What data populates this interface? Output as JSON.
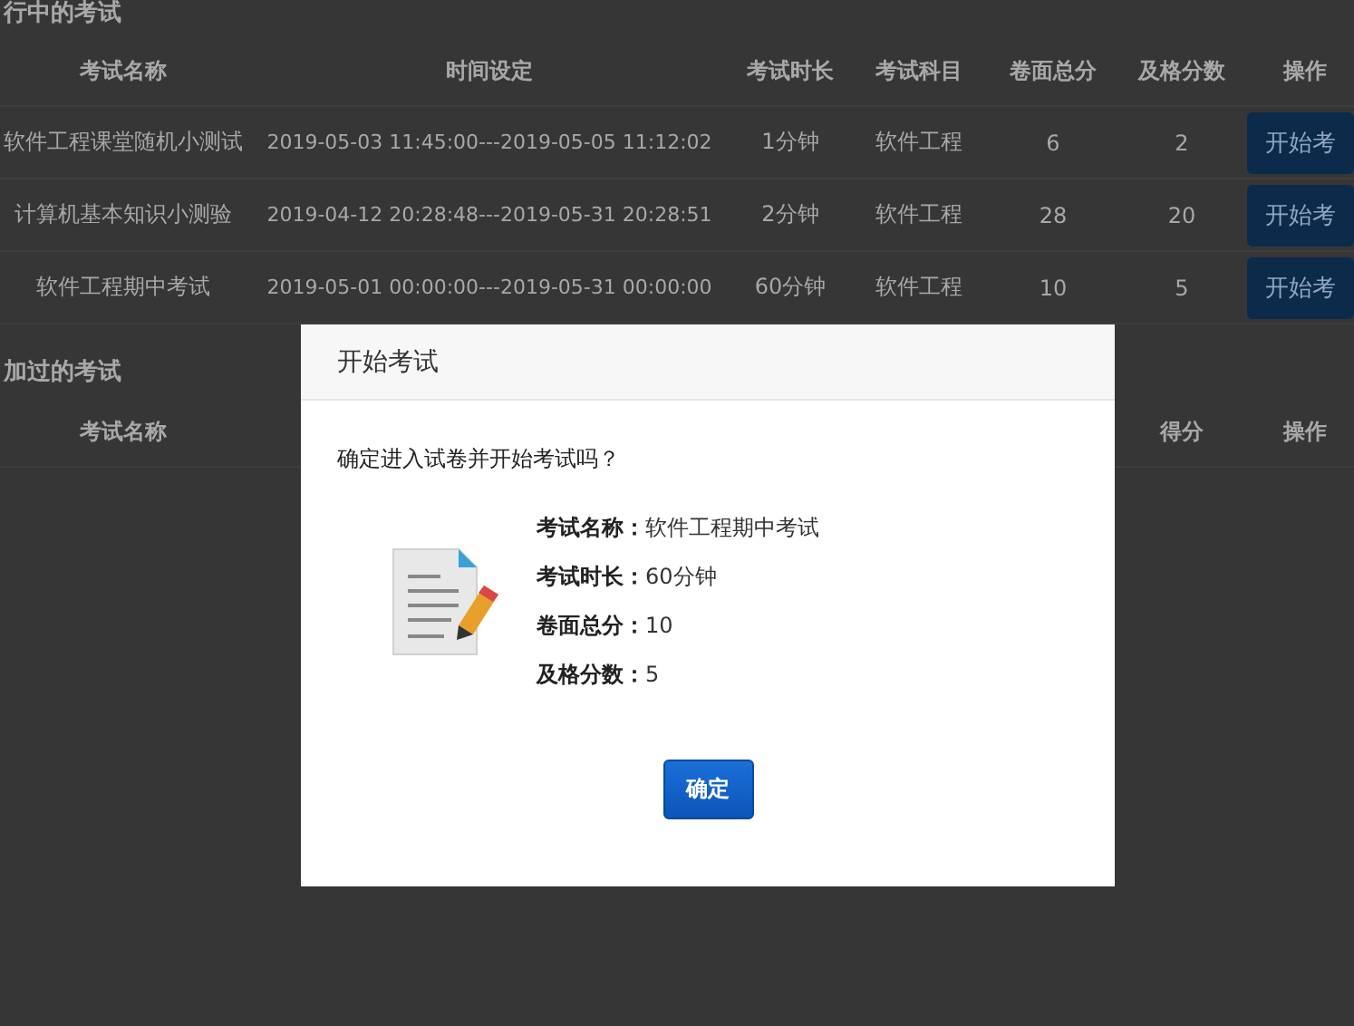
{
  "ongoing": {
    "title": "行中的考试",
    "columns": [
      "考试名称",
      "时间设定",
      "考试时长",
      "考试科目",
      "卷面总分",
      "及格分数",
      "操作"
    ],
    "rows": [
      {
        "name": "软件工程课堂随机小测试",
        "time": "2019-05-03 11:45:00---2019-05-05 11:12:02",
        "duration": "1分钟",
        "subject": "软件工程",
        "total": "6",
        "pass": "2",
        "action": "开始考"
      },
      {
        "name": "计算机基本知识小测验",
        "time": "2019-04-12 20:28:48---2019-05-31 20:28:51",
        "duration": "2分钟",
        "subject": "软件工程",
        "total": "28",
        "pass": "20",
        "action": "开始考"
      },
      {
        "name": "软件工程期中考试",
        "time": "2019-05-01 00:00:00---2019-05-31 00:00:00",
        "duration": "60分钟",
        "subject": "软件工程",
        "total": "10",
        "pass": "5",
        "action": "开始考"
      }
    ]
  },
  "taken": {
    "title": "加过的考试",
    "columns": [
      "考试名称",
      "得分",
      "操作"
    ]
  },
  "dialog": {
    "title": "开始考试",
    "prompt": "确定进入试卷并开始考试吗？",
    "fields": [
      {
        "label": "考试名称：",
        "value": "软件工程期中考试"
      },
      {
        "label": "考试时长：",
        "value": "60分钟"
      },
      {
        "label": "卷面总分：",
        "value": "10"
      },
      {
        "label": "及格分数：",
        "value": "5"
      }
    ],
    "confirm": "确定"
  }
}
